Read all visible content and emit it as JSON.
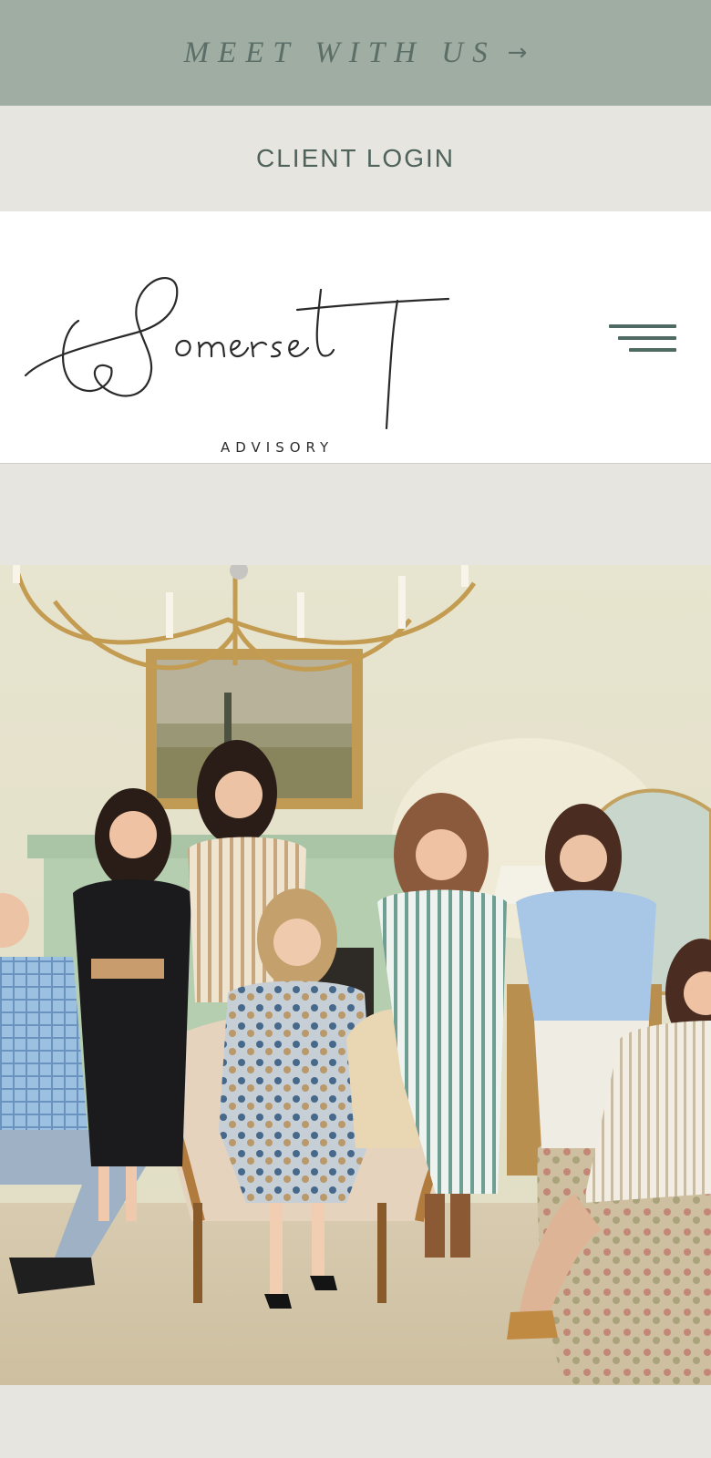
{
  "top_banner": {
    "label": "MEET WITH US",
    "arrow_icon": "arrow-right-icon"
  },
  "login_bar": {
    "label": "CLIENT LOGIN"
  },
  "header": {
    "logo": {
      "script_text": "Somerset",
      "subtitle": "ADVISORY"
    },
    "menu_icon": "hamburger-menu-icon"
  },
  "colors": {
    "banner_bg": "#9fada2",
    "accent_text": "#5b6e67",
    "login_bg": "#e6e5df",
    "menu_icon": "#4f6a62"
  }
}
